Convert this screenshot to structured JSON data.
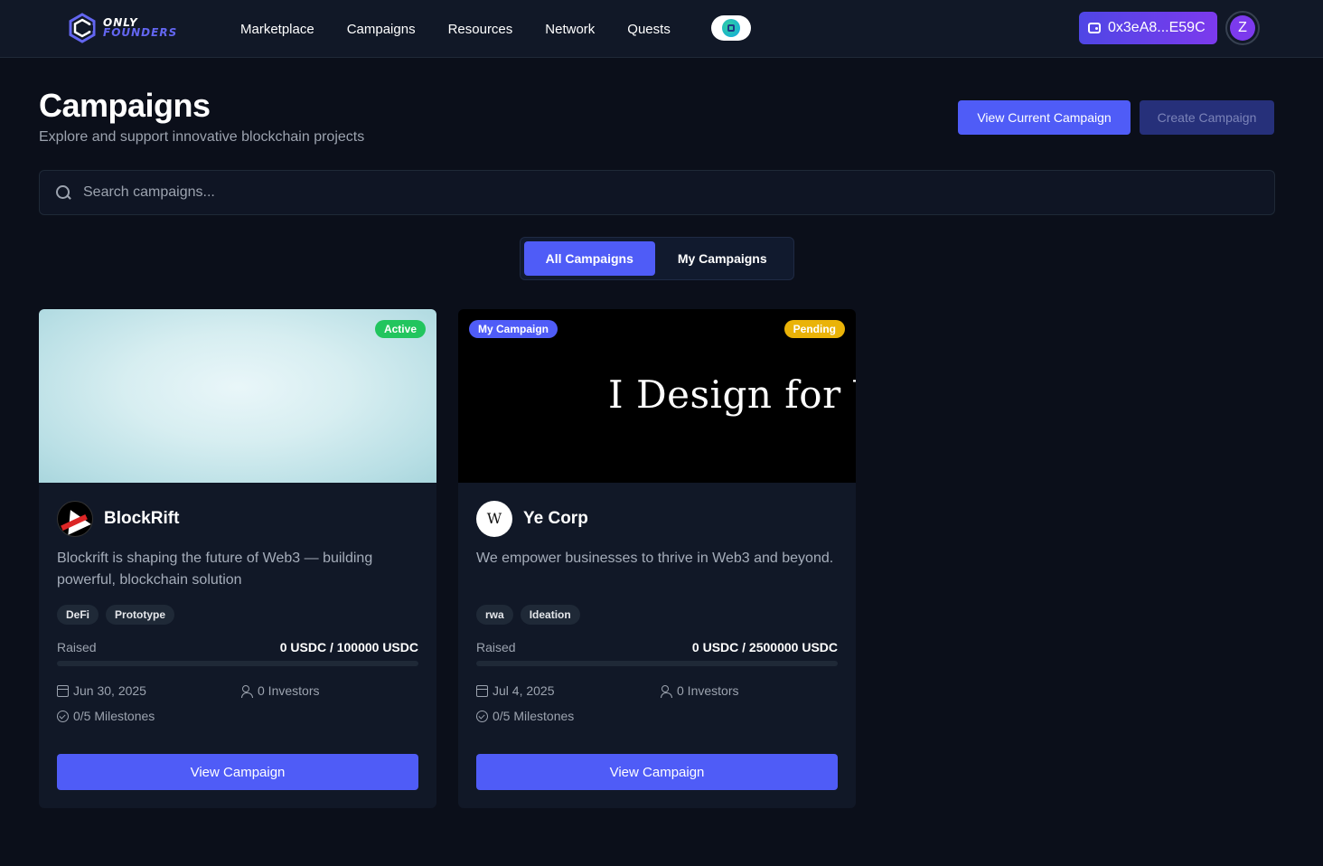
{
  "nav": {
    "logo_line1": "ONLY",
    "logo_line2": "FOUNDERS",
    "links": [
      "Marketplace",
      "Campaigns",
      "Resources",
      "Network",
      "Quests"
    ],
    "wallet_address": "0x3eA8...E59C",
    "avatar_initial": "Z"
  },
  "header": {
    "title": "Campaigns",
    "subtitle": "Explore and support innovative blockchain projects",
    "view_current_label": "View Current Campaign",
    "create_label": "Create Campaign"
  },
  "search": {
    "placeholder": "Search campaigns..."
  },
  "tabs": {
    "all": "All Campaigns",
    "mine": "My Campaigns",
    "selected": "All Campaigns"
  },
  "campaigns": [
    {
      "name": "BlockRift",
      "status": "Active",
      "owner_badge": "",
      "banner_text": "",
      "description": "Blockrift is shaping the future of Web3 — building powerful, blockchain solution",
      "tags": [
        "DeFi",
        "Prototype"
      ],
      "raised_label": "Raised",
      "raised": "0 USDC / 100000 USDC",
      "progress": 0,
      "date": "Jun 30, 2025",
      "investors": "0 Investors",
      "milestones": "0/5 Milestones",
      "button": "View Campaign"
    },
    {
      "name": "Ye Corp",
      "status": "Pending",
      "owner_badge": "My Campaign",
      "banner_text": "I Design for YC",
      "description": "We empower businesses to thrive in Web3 and beyond.",
      "tags": [
        "rwa",
        "Ideation"
      ],
      "raised_label": "Raised",
      "raised": "0 USDC / 2500000 USDC",
      "progress": 0,
      "date": "Jul 4, 2025",
      "investors": "0 Investors",
      "milestones": "0/5 Milestones",
      "button": "View Campaign"
    }
  ],
  "colors": {
    "background": "#0b0f1a",
    "accent": "#4f5cf7",
    "active_badge": "#22c55e",
    "pending_badge": "#eab308"
  }
}
